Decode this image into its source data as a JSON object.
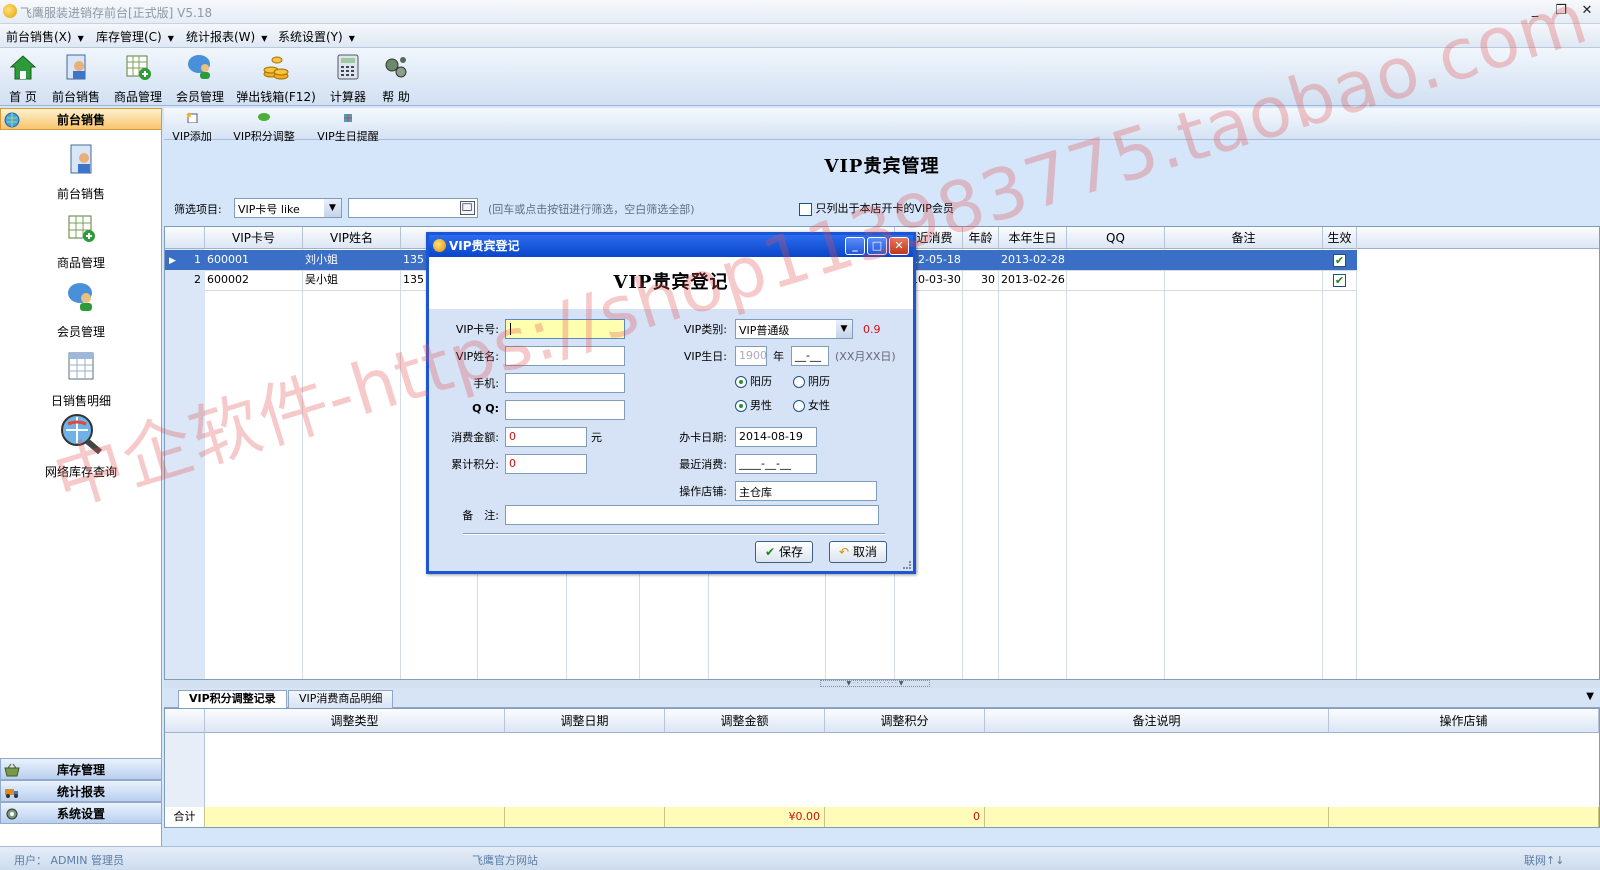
{
  "window": {
    "title": "飞鹰服装进销存前台[正式版] V5.18",
    "minimize": "_",
    "maximize": "❐",
    "close": "✕"
  },
  "menus": [
    "前台销售(X)",
    "库存管理(C)",
    "统计报表(W)",
    "系统设置(Y)"
  ],
  "toolbar": [
    "首 页",
    "前台销售",
    "商品管理",
    "会员管理",
    "弹出钱箱(F12)",
    "计算器",
    "帮 助"
  ],
  "sidebar": {
    "active_header": "前台销售",
    "items": [
      "前台销售",
      "商品管理",
      "会员管理",
      "日销售明细",
      "网络库存查询"
    ],
    "bottom_headers": [
      "库存管理",
      "统计报表",
      "系统设置"
    ]
  },
  "subtoolbar": [
    "VIP添加",
    "VIP积分调整",
    "VIP生日提醒"
  ],
  "page": {
    "title": "VIP贵宾管理",
    "filter_label": "筛选项目:",
    "filter_select": "VIP卡号 like",
    "filter_value": "",
    "filter_hint": "(回车或点击按钮进行筛选，空白筛选全部)",
    "only_this_store": "只列出于本店开卡的VIP会员"
  },
  "grid": {
    "columns": [
      "VIP卡号",
      "VIP姓名",
      "最近消费",
      "年龄",
      "本年生日",
      "QQ",
      "备注",
      "生效"
    ],
    "rows": [
      {
        "no": "1",
        "card": "600001",
        "name": "刘小姐",
        "phone": "135",
        "recent": "2012-05-18",
        "age": "",
        "birthday": "2013-02-28",
        "qq": "",
        "remark": "",
        "active": true
      },
      {
        "no": "2",
        "card": "600002",
        "name": "吴小姐",
        "phone": "135",
        "recent": "2010-03-30",
        "age": "30",
        "birthday": "2013-02-26",
        "qq": "",
        "remark": "",
        "active": true
      }
    ]
  },
  "bottom": {
    "tabs": [
      "VIP积分调整记录",
      "VIP消费商品明细"
    ],
    "columns": [
      "调整类型",
      "调整日期",
      "调整金额",
      "调整积分",
      "备注说明",
      "操作店铺"
    ],
    "total_label": "合计",
    "total_amount": "¥0.00",
    "total_points": "0"
  },
  "status": {
    "user": "用户： ADMIN 管理员",
    "site": "飞鹰官方网站",
    "net": "联网↑↓"
  },
  "watermark": "中企软件-https://shop113983775.taobao.com",
  "dialog": {
    "title": "VIP贵宾登记",
    "heading": "VIP贵宾登记",
    "fields": {
      "card_label": "VIP卡号:",
      "card_value": "",
      "name_label": "VIP姓名:",
      "name_value": "",
      "phone_label": "手机:",
      "phone_value": "",
      "qq_label": "Q Q:",
      "qq_value": "",
      "amount_label": "消费金额:",
      "amount_value": "0",
      "amount_unit": "元",
      "points_label": "累计积分:",
      "points_value": "0",
      "remark_label": "备　注:",
      "remark_value": "",
      "type_label": "VIP类别:",
      "type_value": "VIP普通级",
      "discount": "0.9",
      "birthday_label": "VIP生日:",
      "birth_year": "1900",
      "year_unit": "年",
      "birth_md": "__-__",
      "birth_hint": "(XX月XX日)",
      "solar": "阳历",
      "lunar": "阴历",
      "male": "男性",
      "female": "女性",
      "open_date_label": "办卡日期:",
      "open_date_value": "2014-08-19",
      "recent_label": "最近消费:",
      "recent_value": "____-__-__",
      "store_label": "操作店铺:",
      "store_value": "主仓库"
    },
    "save": "保存",
    "cancel": "取消"
  }
}
